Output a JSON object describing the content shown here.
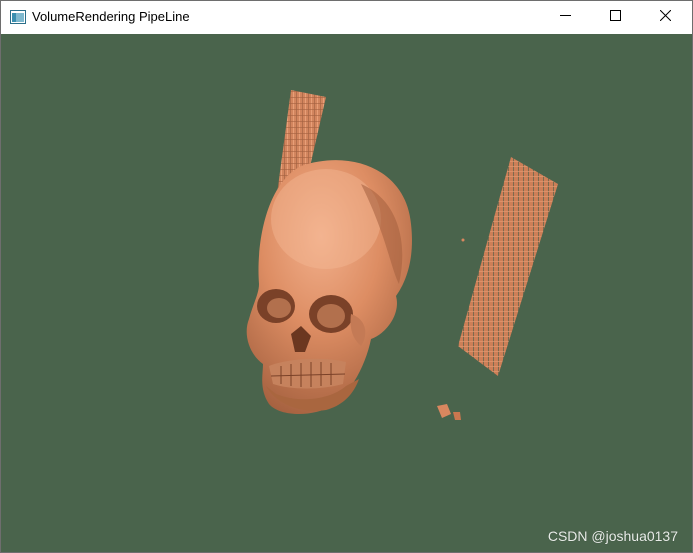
{
  "window": {
    "title": "VolumeRendering PipeLine",
    "controls": {
      "minimize_icon": "minimize-icon",
      "maximize_icon": "maximize-icon",
      "close_icon": "close-icon"
    }
  },
  "viewport": {
    "background_color": "#4a644c",
    "render_color": "#d9875f",
    "watermark": "CSDN @joshua0137"
  }
}
